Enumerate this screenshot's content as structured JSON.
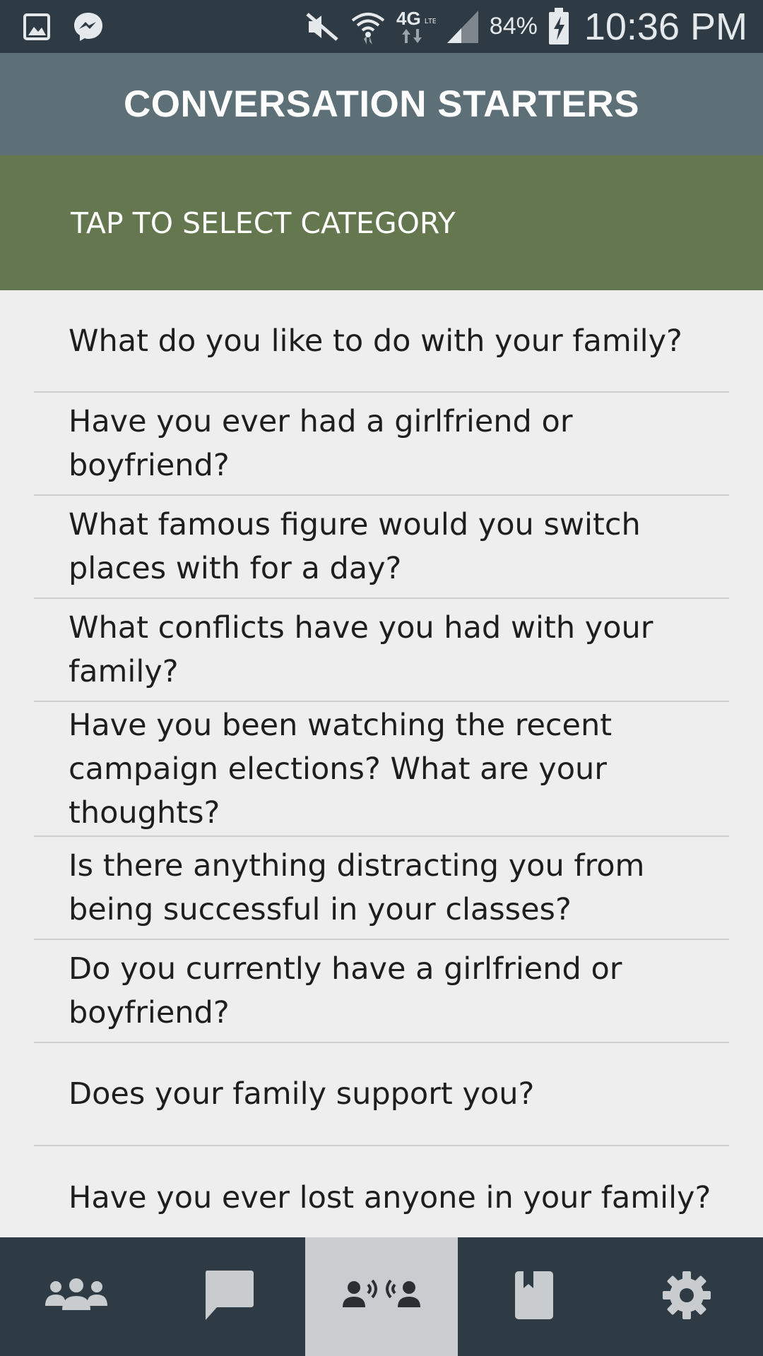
{
  "status_bar": {
    "icons_left": [
      "gallery-notification-icon",
      "messenger-notification-icon"
    ],
    "icons_right": [
      "mute-icon",
      "wifi-icon",
      "4g-lte-icon",
      "signal-icon",
      "battery-charging-icon"
    ],
    "battery_percent": "84%",
    "time": "10:36 PM"
  },
  "header": {
    "title": "CONVERSATION STARTERS"
  },
  "category_selector": {
    "label": "TAP TO SELECT CATEGORY"
  },
  "questions": [
    "What do you like to do with your family?",
    "Have you ever had a girlfriend or boyfriend?",
    "What famous figure would you switch places with for a day?",
    "What conflicts have you had with your family?",
    "Have you been watching the recent campaign elections? What are your thoughts?",
    "Is there anything distracting you from being successful in your classes?",
    "Do you currently have a girlfriend or boyfriend?",
    "Does your family support you?",
    "Have you ever lost anyone in your family?"
  ],
  "bottom_nav": {
    "tabs": [
      "group-icon",
      "chat-bubble-icon",
      "conversation-icon",
      "book-icon",
      "settings-gear-icon"
    ],
    "active_tab": "conversation-icon"
  },
  "colors": {
    "status_bar": "#2f3b44",
    "title_bar": "#5d7078",
    "category_bar": "#65774f",
    "list_background": "#eeeeee",
    "nav_background": "#2f3b44",
    "nav_active": "#cbccd0",
    "divider": "#cfcfcf"
  }
}
